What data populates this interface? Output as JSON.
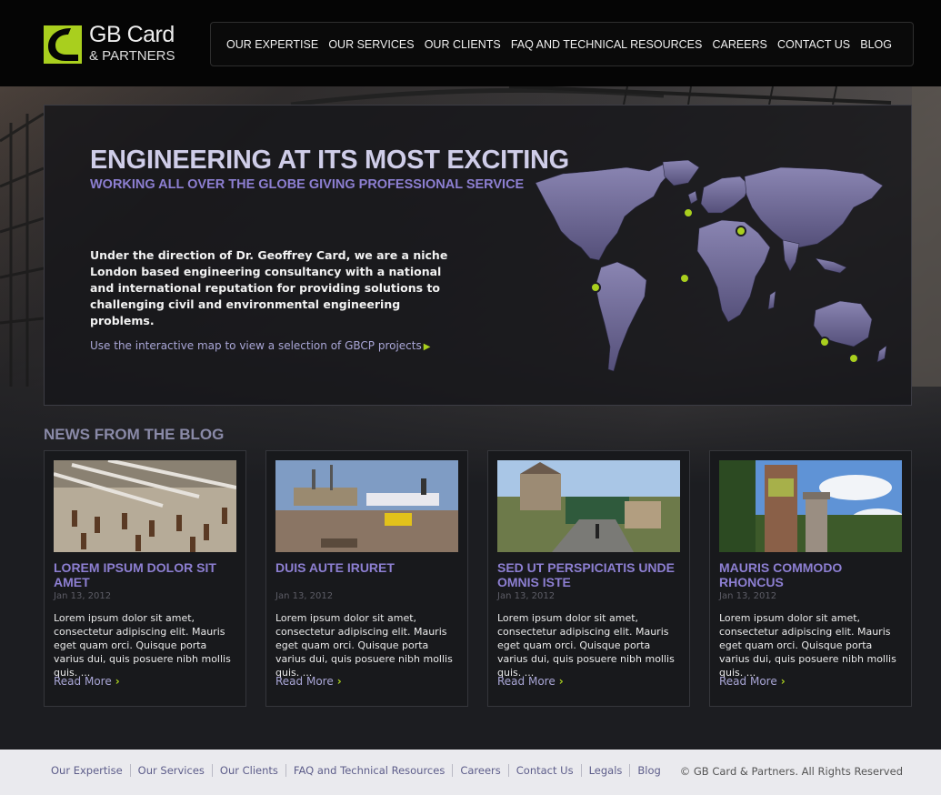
{
  "brand": {
    "name": "GB Card",
    "sub": "& PARTNERS",
    "accent": "#a9cf1e",
    "purple": "#8d7fd2"
  },
  "nav": {
    "items": [
      {
        "label": "OUR EXPERTISE"
      },
      {
        "label": "OUR SERVICES"
      },
      {
        "label": "OUR CLIENTS"
      },
      {
        "label": "FAQ AND TECHNICAL RESOURCES"
      },
      {
        "label": "CAREERS"
      },
      {
        "label": "CONTACT US"
      },
      {
        "label": "BLOG"
      }
    ]
  },
  "hero": {
    "title": "ENGINEERING AT ITS MOST EXCITING",
    "subtitle": "WORKING ALL OVER THE GLOBE GIVING PROFESSIONAL SERVICE",
    "body": "Under the direction of Dr. Geoffrey Card, we are a niche London based engineering consultancy with a national and international reputation for providing solutions to challenging civil and environmental engineering problems.",
    "link": "Use the interactive map to view a selection of GBCP projects",
    "map_icon": "world-map"
  },
  "news": {
    "heading": "NEWS FROM THE BLOG",
    "posts": [
      {
        "title": "LOREM IPSUM DOLOR SIT AMET",
        "date": "Jan 13, 2012",
        "body": "Lorem ipsum dolor sit amet, consectetur adipiscing elit. Mauris eget quam orci. Quisque porta varius dui, quis posuere nibh mollis quis. ...",
        "more": "Read More"
      },
      {
        "title": "DUIS AUTE IRURET",
        "date": "Jan 13, 2012",
        "body": "Lorem ipsum dolor sit amet, consectetur adipiscing elit. Mauris eget quam orci. Quisque porta varius dui, quis posuere nibh mollis quis. ...",
        "more": "Read More"
      },
      {
        "title": "SED UT PERSPICIATIS UNDE OMNIS ISTE",
        "date": "Jan 13, 2012",
        "body": "Lorem ipsum dolor sit amet, consectetur adipiscing elit. Mauris eget quam orci. Quisque porta varius dui, quis posuere nibh mollis quis. ...",
        "more": "Read More"
      },
      {
        "title": "MAURIS COMMODO RHONCUS",
        "date": "Jan 13, 2012",
        "body": "Lorem ipsum dolor sit amet, consectetur adipiscing elit. Mauris eget quam orci. Quisque porta varius dui, quis posuere nibh mollis quis. ...",
        "more": "Read More"
      }
    ]
  },
  "footer": {
    "links": [
      {
        "label": "Our Expertise"
      },
      {
        "label": "Our Services"
      },
      {
        "label": "Our Clients"
      },
      {
        "label": "FAQ and Technical Resources"
      },
      {
        "label": "Careers"
      },
      {
        "label": "Contact Us"
      },
      {
        "label": "Legals"
      },
      {
        "label": "Blog"
      }
    ],
    "copyright": "© GB Card & Partners. All Rights Reserved"
  }
}
